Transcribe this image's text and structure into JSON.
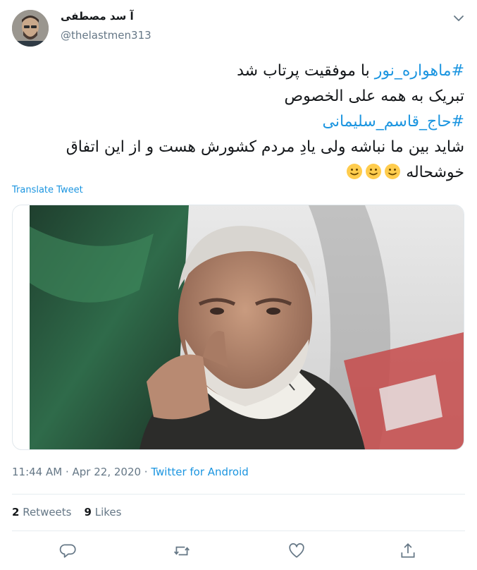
{
  "author": {
    "display_name": "آ سد مصطفی",
    "handle": "@thelastmen313"
  },
  "tweet": {
    "line1_hashtag": "#ماهواره_نور",
    "line1_rest": " با موفقیت پرتاب شد",
    "line2": "تبریک به همه علی الخصوص",
    "line3_hashtag": "#حاج_قاسم_سلیمانی",
    "line4": "شاید بین ما نباشه ولی یادِ مردم کشورش هست و از این اتفاق",
    "line5": "خوشحاله",
    "emojis": [
      "slightly-smiling-face",
      "slightly-smiling-face",
      "slightly-smiling-face"
    ]
  },
  "translate_label": "Translate Tweet",
  "meta": {
    "time": "11:44 AM",
    "separator": " · ",
    "date": "Apr 22, 2020",
    "source": "Twitter for Android"
  },
  "stats": {
    "retweets_count": "2",
    "retweets_label": " Retweets",
    "likes_count": "9",
    "likes_label": " Likes"
  },
  "actions": [
    "reply-icon",
    "retweet-icon",
    "like-icon",
    "share-icon"
  ],
  "colors": {
    "link": "#1b95e0",
    "secondary_text": "#657786",
    "divider": "#e6ecf0"
  }
}
